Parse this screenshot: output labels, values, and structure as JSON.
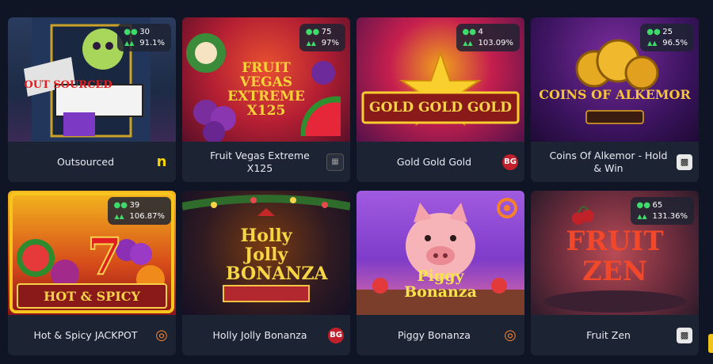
{
  "colors": {
    "background": "#0f1525",
    "card": "#1c2333",
    "accent_green": "#3ddc6a"
  },
  "games": [
    {
      "name": "Outsourced",
      "players": "30",
      "rtp": "91.1%",
      "provider_icon": "n-logo-icon",
      "art_text": "OUT SOURCED"
    },
    {
      "name": "Fruit Vegas Extreme X125",
      "players": "75",
      "rtp": "97%",
      "provider_icon": "grid-logo-icon",
      "art_text": "FRUIT VEGAS EXTREME X125"
    },
    {
      "name": "Gold Gold Gold",
      "players": "4",
      "rtp": "103.09%",
      "provider_icon": "bg-logo-icon",
      "provider_text": "BG",
      "art_text": "GOLD GOLD GOLD"
    },
    {
      "name": "Coins Of Alkemor - Hold & Win",
      "players": "25",
      "rtp": "96.5%",
      "provider_icon": "game-logo-icon",
      "art_text": "COINS OF ALKEMOR"
    },
    {
      "name": "Hot & Spicy JACKPOT",
      "players": "39",
      "rtp": "106.87%",
      "provider_icon": "target-logo-icon",
      "art_text": "HOT & SPICY"
    },
    {
      "name": "Holly Jolly Bonanza",
      "provider_icon": "bg-logo-icon",
      "provider_text": "BG",
      "art_text": "Holly Jolly BONANZA"
    },
    {
      "name": "Piggy Bonanza",
      "provider_icon": "target-logo-icon",
      "art_text": "Piggy Bonanza"
    },
    {
      "name": "Fruit Zen",
      "players": "65",
      "rtp": "131.36%",
      "provider_icon": "game-logo-icon",
      "art_text": "FRUIT ZEN"
    }
  ]
}
